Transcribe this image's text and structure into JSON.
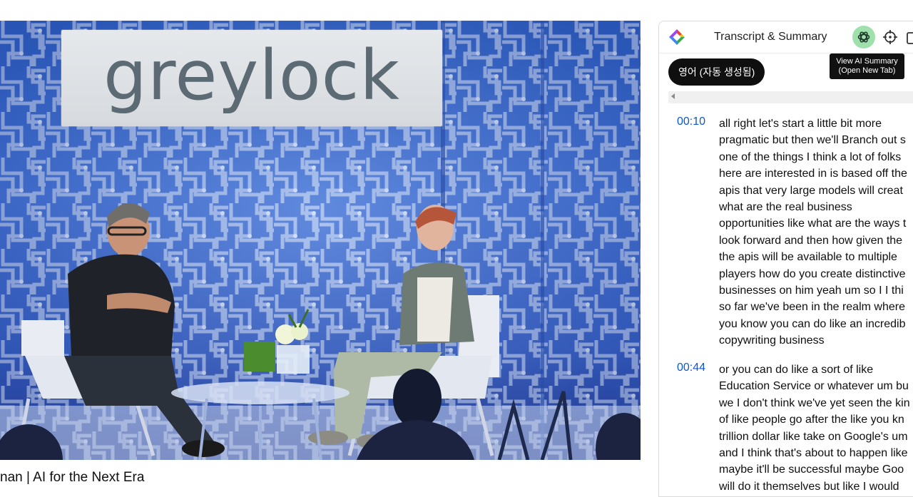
{
  "video": {
    "sign_text": "greylock",
    "title": "nan | AI for the Next Era"
  },
  "panel": {
    "title": "Transcript & Summary",
    "tooltip": [
      "View AI Summary",
      "(Open New Tab)"
    ],
    "language_button": "영어 (자동 생성됨)",
    "transcript": [
      {
        "time": "00:10",
        "lines": [
          "all right let's start a little bit more",
          "pragmatic but then we'll Branch out s",
          "one of the things I think a lot of folks",
          "here are interested in is based off the",
          "apis that very large models will creat",
          "what are the real business",
          "opportunities like what are the ways t",
          "look forward and then how given the",
          "the apis will be available to multiple",
          "players how do you create distinctive",
          "businesses on him yeah um so I I thi",
          "so far we've been in the realm where",
          "you know you can do like an incredib",
          "copywriting business"
        ]
      },
      {
        "time": "00:44",
        "lines": [
          "or you can do like a sort of like",
          "Education Service or whatever um bu",
          "we I don't think we've yet seen the kin",
          "of like people go after the like you kn",
          "trillion dollar like take on Google's um",
          "and I think that's about to happen like",
          "maybe it'll be successful maybe Goo",
          "will do it themselves but like I would"
        ]
      }
    ]
  }
}
